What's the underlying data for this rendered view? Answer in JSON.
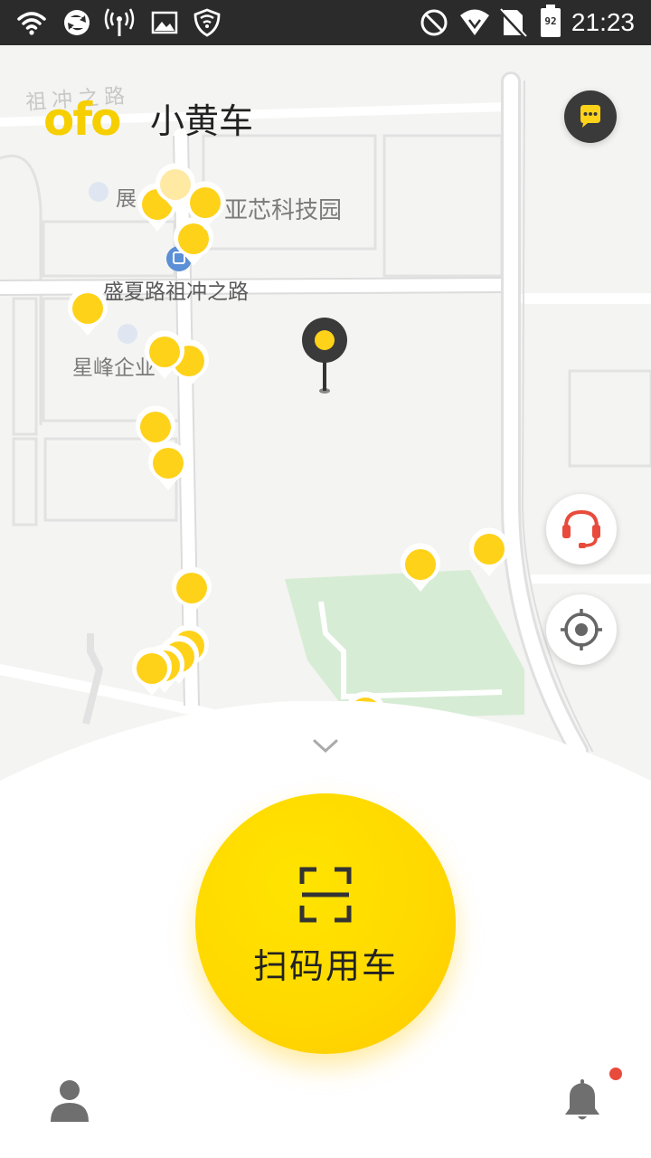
{
  "status_bar": {
    "time": "21:23",
    "battery": "92"
  },
  "app": {
    "brand": "ofo",
    "name": "小黄车"
  },
  "map": {
    "labels": {
      "road_top": "祖冲之路",
      "poi_zhan": "展",
      "park": "亚芯科技园",
      "bus_stop": "盛夏路祖冲之路",
      "poi_xingfeng": "星峰企业"
    }
  },
  "bottom": {
    "scan_label": "扫码用车"
  },
  "colors": {
    "brand_yellow": "#ffd800",
    "dark": "#2b2b2b",
    "service_red": "#e84b3c",
    "park_green": "#d7ecd5"
  },
  "icons": [
    "chat-icon",
    "customer-service-icon",
    "locate-icon",
    "scan-icon",
    "user-icon",
    "bell-icon",
    "location-pin-icon",
    "bike-marker-icon"
  ]
}
